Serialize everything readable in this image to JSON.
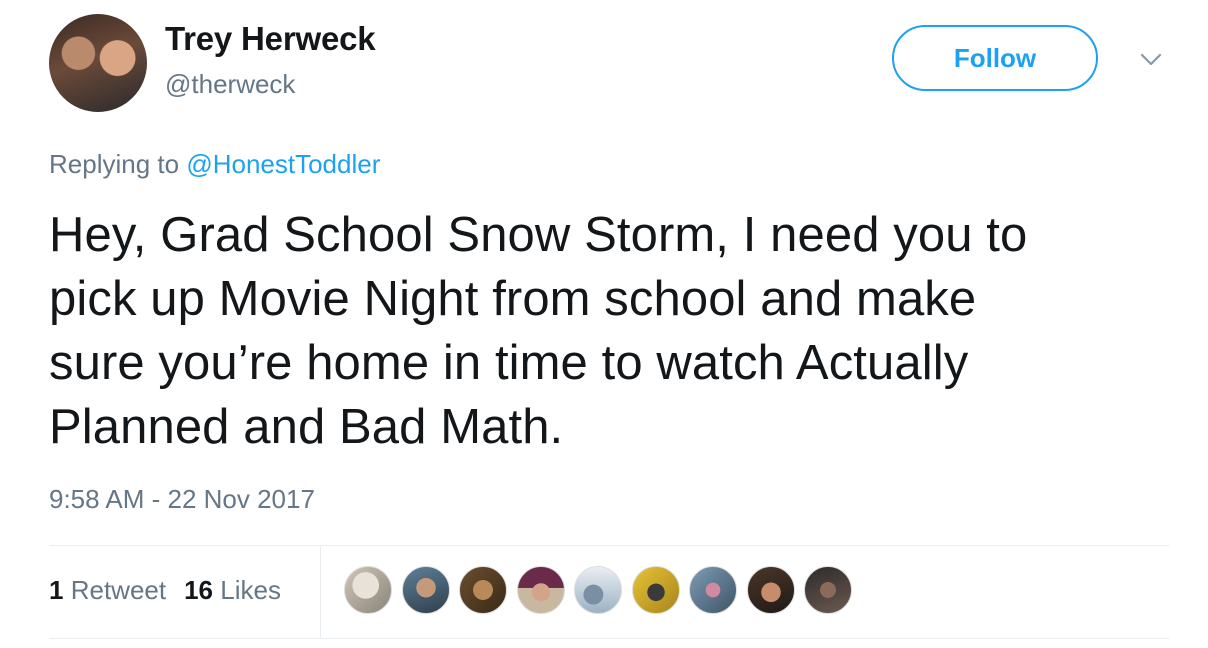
{
  "tweet": {
    "author_name": "Trey Herweck",
    "author_handle": "@therweck",
    "follow_label": "Follow",
    "replying_prefix": "Replying to ",
    "replying_to": "@HonestToddler",
    "lines": [
      "Hey, Grad School Snow Storm, I need you to",
      "pick up Movie Night from school and make",
      "sure you’re home in time to watch Actually",
      "Planned and Bad Math."
    ],
    "timestamp": "9:58 AM - 22 Nov 2017",
    "retweet_count": "1",
    "retweet_label": "Retweet",
    "like_count": "16",
    "like_label": "Likes"
  },
  "colors": {
    "accent": "#1da1f2",
    "secondary_text": "#657786",
    "primary_text": "#14171a",
    "divider": "#e6ecf0"
  },
  "icons": {
    "more": "chevron-down-icon"
  },
  "liker_avatars": [
    "liker-avatar-1",
    "liker-avatar-2",
    "liker-avatar-3",
    "liker-avatar-4",
    "liker-avatar-5",
    "liker-avatar-6",
    "liker-avatar-7",
    "liker-avatar-8",
    "liker-avatar-9"
  ]
}
